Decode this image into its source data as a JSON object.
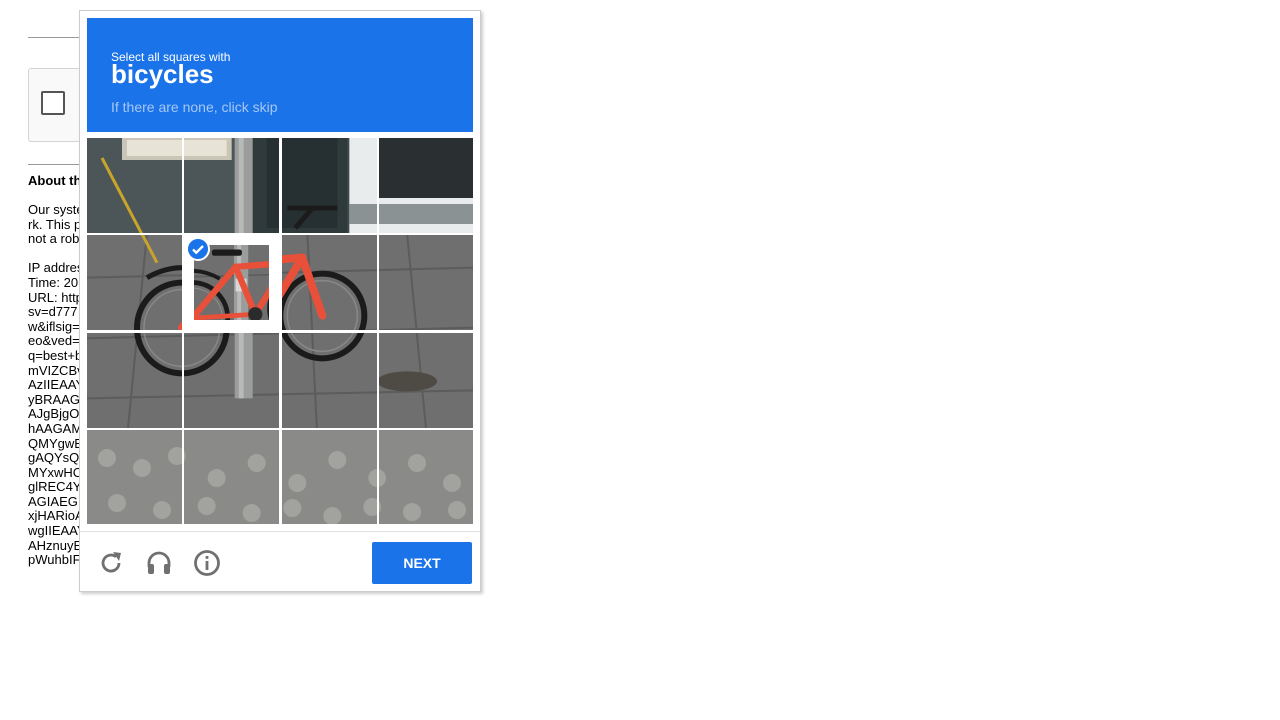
{
  "background_page": {
    "about_title": "About th",
    "about_lines": [
      "Our syste",
      "rk. This p",
      "not a rob",
      "",
      "IP addres",
      "Time: 20",
      "URL: http",
      "sv=d777",
      "w&iflsig=",
      "eo&ved=",
      "q=best+b",
      "mVIZCBv",
      "AzIIEAAY",
      "yBRAAG",
      "AJgBjgO",
      "hAAGAM",
      "QMYgwE",
      "gAQYsQ",
      "MYxwHC",
      "glREC4Y",
      "AGIAEG",
      "xjHARioA",
      "wgIIEAAY",
      "AHznuyE",
      "pWuhbIF"
    ]
  },
  "challenge": {
    "header": {
      "instruction": "Select all squares with",
      "target": "bicycles",
      "hint": "If there are none, click skip"
    },
    "grid": {
      "rows": 4,
      "cols": 4,
      "selected_tiles": [
        5
      ]
    },
    "footer": {
      "reload_icon": "reload-icon",
      "audio_icon": "headphones-icon",
      "info_icon": "info-icon",
      "next_label": "NEXT"
    },
    "colors": {
      "accent": "#1a73e8",
      "hint": "#a7c7f5"
    }
  }
}
